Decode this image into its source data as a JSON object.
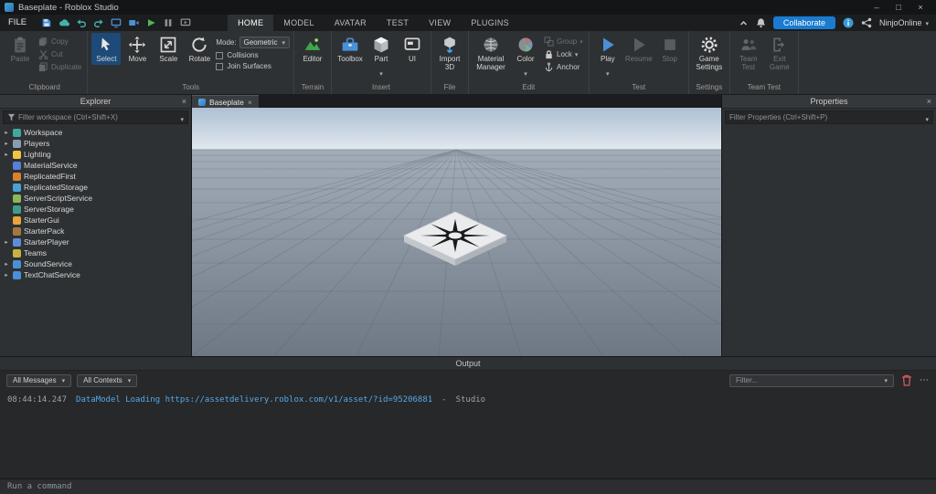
{
  "accent": {
    "collaborate_blue": "#1a7bd0",
    "link_blue": "#56a8e8",
    "tool_selected_bg": "#1d4a78",
    "trash_red": "#d65c5c"
  },
  "titlebar": {
    "title": "Baseplate - Roblox Studio",
    "minimize": "–",
    "maximize": "□",
    "close": "×"
  },
  "menubar": {
    "file_label": "FILE",
    "tabs": [
      {
        "label": "HOME"
      },
      {
        "label": "MODEL"
      },
      {
        "label": "AVATAR"
      },
      {
        "label": "TEST"
      },
      {
        "label": "VIEW"
      },
      {
        "label": "PLUGINS"
      }
    ],
    "collaborate_label": "Collaborate",
    "username": "NinjoOnline"
  },
  "ribbon": {
    "clipboard": {
      "label": "Clipboard",
      "paste": "Paste",
      "copy": "Copy",
      "cut": "Cut",
      "duplicate": "Duplicate"
    },
    "tools": {
      "label": "Tools",
      "select": "Select",
      "move": "Move",
      "scale": "Scale",
      "rotate": "Rotate",
      "mode_label": "Mode:",
      "mode_value": "Geometric",
      "collisions": "Collisions",
      "join_surfaces": "Join Surfaces"
    },
    "terrain": {
      "label": "Terrain",
      "editor": "Editor"
    },
    "insert": {
      "label": "Insert",
      "toolbox": "Toolbox",
      "part": "Part",
      "ui": "UI"
    },
    "file": {
      "label": "File",
      "import3d": "Import 3D"
    },
    "edit": {
      "label": "Edit",
      "material_manager": "Material Manager",
      "color": "Color",
      "group": "Group",
      "lock": "Lock",
      "anchor": "Anchor"
    },
    "test": {
      "label": "Test",
      "play": "Play",
      "resume": "Resume",
      "stop": "Stop"
    },
    "settings": {
      "label": "Settings",
      "game_settings": "Game Settings"
    },
    "team_test": {
      "label": "Team Test",
      "team_test": "Team Test",
      "exit_game": "Exit Game"
    }
  },
  "explorer": {
    "title": "Explorer",
    "close_label": "×",
    "filter_placeholder": "Filter workspace (Ctrl+Shift+X)",
    "items": [
      {
        "label": "Workspace",
        "color": "#3fa8a0",
        "arrow": "▸"
      },
      {
        "label": "Players",
        "color": "#8a9cb5",
        "arrow": "▸"
      },
      {
        "label": "Lighting",
        "color": "#f0c43f",
        "arrow": "▸"
      },
      {
        "label": "MaterialService",
        "color": "#5a7fd6",
        "arrow": ""
      },
      {
        "label": "ReplicatedFirst",
        "color": "#d9822b",
        "arrow": ""
      },
      {
        "label": "ReplicatedStorage",
        "color": "#4aa0d9",
        "arrow": ""
      },
      {
        "label": "ServerScriptService",
        "color": "#8fb55a",
        "arrow": ""
      },
      {
        "label": "ServerStorage",
        "color": "#3f9c8a",
        "arrow": ""
      },
      {
        "label": "StarterGui",
        "color": "#e8a33d",
        "arrow": ""
      },
      {
        "label": "StarterPack",
        "color": "#a5773f",
        "arrow": ""
      },
      {
        "label": "StarterPlayer",
        "color": "#5a8fd6",
        "arrow": "▸"
      },
      {
        "label": "Teams",
        "color": "#c9b23f",
        "arrow": ""
      },
      {
        "label": "SoundService",
        "color": "#4a90d9",
        "arrow": "▸"
      },
      {
        "label": "TextChatService",
        "color": "#4a90d9",
        "arrow": "▸"
      }
    ]
  },
  "viewport": {
    "tab_label": "Baseplate",
    "close_label": "×"
  },
  "properties": {
    "title": "Properties",
    "close_label": "×",
    "filter_placeholder": "Filter Properties (Ctrl+Shift+P)"
  },
  "output": {
    "title": "Output",
    "messages_dropdown": "All Messages",
    "contexts_dropdown": "All Contexts",
    "filter_placeholder": "Filter...",
    "more_label": "⋯",
    "log": [
      {
        "time": "08:44:14.247",
        "message": "DataModel Loading https://assetdelivery.roblox.com/v1/asset/?id=95206881",
        "separator": "-",
        "context": "Studio"
      }
    ]
  },
  "command_bar": {
    "placeholder": "Run a command"
  }
}
